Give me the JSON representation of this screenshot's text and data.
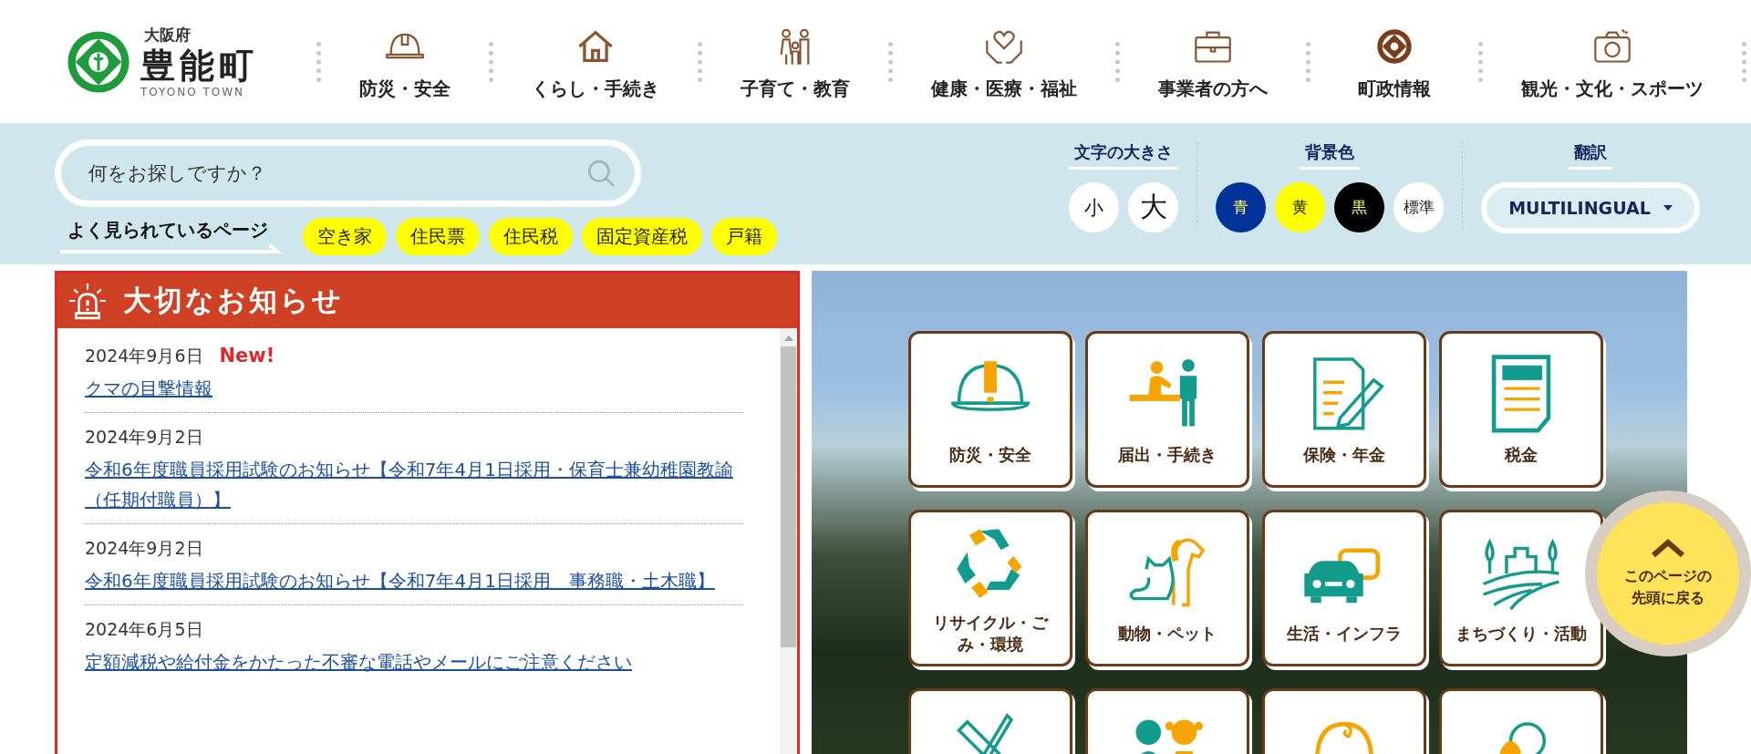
{
  "header": {
    "logo": {
      "prefecture": "大阪府",
      "town": "豊能町",
      "romaji": "TOYONO TOWN"
    },
    "nav": [
      {
        "label": "防災・安全"
      },
      {
        "label": "くらし・手続き"
      },
      {
        "label": "子育て・教育"
      },
      {
        "label": "健康・医療・福祉"
      },
      {
        "label": "事業者の方へ"
      },
      {
        "label": "町政情報"
      },
      {
        "label": "観光・文化・スポーツ"
      }
    ]
  },
  "search": {
    "placeholder": "何をお探しですか？"
  },
  "popular": {
    "label": "よく見られているページ",
    "tags": [
      "空き家",
      "住民票",
      "住民税",
      "固定資産税",
      "戸籍"
    ]
  },
  "font_size": {
    "title": "文字の大きさ",
    "buttons": [
      "小",
      "大"
    ]
  },
  "background_color": {
    "title": "背景色",
    "options": [
      {
        "label": "青",
        "color": "#003399"
      },
      {
        "label": "黄",
        "color": "#ffff00"
      },
      {
        "label": "黒",
        "color": "#000000"
      },
      {
        "label": "標準",
        "color": "#ffffff"
      }
    ]
  },
  "translate": {
    "title": "翻訳",
    "button": "MULTILINGUAL"
  },
  "notices": {
    "title": "大切なお知らせ",
    "items": [
      {
        "date": "2024年9月6日",
        "badge": "New!",
        "title": "クマの目撃情報"
      },
      {
        "date": "2024年9月2日",
        "title": "令和6年度職員採用試験のお知らせ【令和7年4月1日採用・保育士兼幼稚園教諭（任期付職員）】"
      },
      {
        "date": "2024年9月2日",
        "title": "令和6年度職員採用試験のお知らせ【令和7年4月1日採用　事務職・土木職】"
      },
      {
        "date": "2024年6月5日",
        "title": "定額減税や給付金をかたった不審な電話やメールにご注意ください"
      }
    ]
  },
  "categories": [
    {
      "kind": "full",
      "label": "防災・安全"
    },
    {
      "kind": "full",
      "label": "届出・手続き"
    },
    {
      "kind": "full",
      "label": "保険・年金"
    },
    {
      "kind": "full",
      "label": "税金"
    },
    {
      "kind": "full",
      "label": "リサイクル・ごみ・環境"
    },
    {
      "kind": "full",
      "label": "動物・ペット"
    },
    {
      "kind": "full",
      "label": "生活・インフラ"
    },
    {
      "kind": "full",
      "label": "まちづくり・活動"
    },
    {
      "kind": "partial"
    },
    {
      "kind": "partial"
    },
    {
      "kind": "partial"
    },
    {
      "kind": "partial"
    }
  ],
  "back_to_top": {
    "label": "このページの先頭に戻る"
  }
}
